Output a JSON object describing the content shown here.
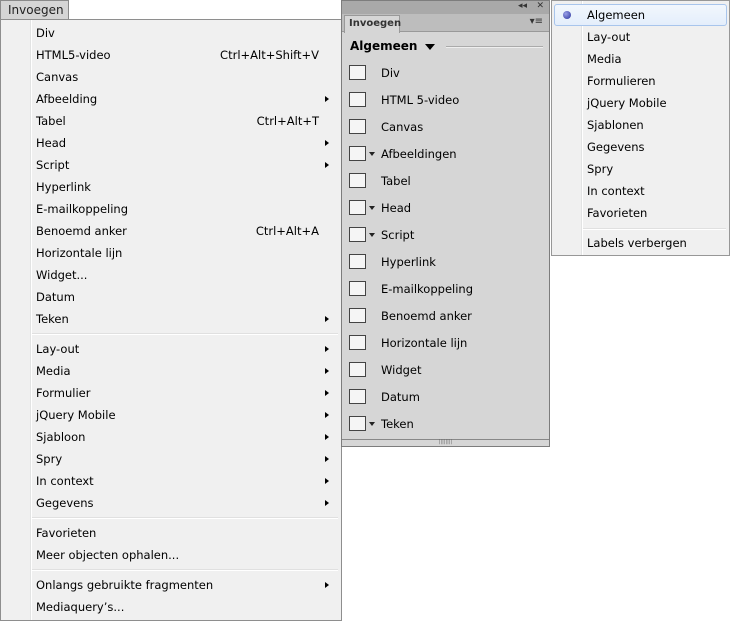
{
  "menubar": {
    "title": "Invoegen"
  },
  "menu": {
    "items": [
      {
        "label": "Div",
        "shortcut": "",
        "sub": false
      },
      {
        "label": "HTML5-video",
        "shortcut": "Ctrl+Alt+Shift+V",
        "sub": false
      },
      {
        "label": "Canvas",
        "shortcut": "",
        "sub": false
      },
      {
        "label": "Afbeelding",
        "shortcut": "",
        "sub": true
      },
      {
        "label": "Tabel",
        "shortcut": "Ctrl+Alt+T",
        "sub": false
      },
      {
        "label": "Head",
        "shortcut": "",
        "sub": true
      },
      {
        "label": "Script",
        "shortcut": "",
        "sub": true
      },
      {
        "label": "Hyperlink",
        "shortcut": "",
        "sub": false
      },
      {
        "label": "E-mailkoppeling",
        "shortcut": "",
        "sub": false
      },
      {
        "label": "Benoemd anker",
        "shortcut": "Ctrl+Alt+A",
        "sub": false
      },
      {
        "label": "Horizontale lijn",
        "shortcut": "",
        "sub": false
      },
      {
        "label": "Widget...",
        "shortcut": "",
        "sub": false
      },
      {
        "label": "Datum",
        "shortcut": "",
        "sub": false
      },
      {
        "label": "Teken",
        "shortcut": "",
        "sub": true
      },
      {
        "sep": true
      },
      {
        "label": "Lay-out",
        "shortcut": "",
        "sub": true
      },
      {
        "label": "Media",
        "shortcut": "",
        "sub": true
      },
      {
        "label": "Formulier",
        "shortcut": "",
        "sub": true
      },
      {
        "label": "jQuery Mobile",
        "shortcut": "",
        "sub": true
      },
      {
        "label": "Sjabloon",
        "shortcut": "",
        "sub": true
      },
      {
        "label": "Spry",
        "shortcut": "",
        "sub": true
      },
      {
        "label": "In context",
        "shortcut": "",
        "sub": true
      },
      {
        "label": "Gegevens",
        "shortcut": "",
        "sub": true
      },
      {
        "sep": true
      },
      {
        "label": "Favorieten",
        "shortcut": "",
        "sub": false
      },
      {
        "label": "Meer objecten ophalen...",
        "shortcut": "",
        "sub": false
      },
      {
        "sep": true
      },
      {
        "label": "Onlangs gebruikte fragmenten",
        "shortcut": "",
        "sub": true
      },
      {
        "label": "Mediaquery’s...",
        "shortcut": "",
        "sub": false
      }
    ]
  },
  "panel": {
    "tab": "Invoegen",
    "collapse": "◂◂",
    "close": "✕",
    "options": "▾≡",
    "category": "Algemeen",
    "items": [
      {
        "label": "Div",
        "icon": "div-icon",
        "dd": false
      },
      {
        "label": "HTML 5-video",
        "icon": "film-icon",
        "dd": false
      },
      {
        "label": "Canvas",
        "icon": "pencil-icon",
        "dd": false
      },
      {
        "label": "Afbeeldingen",
        "icon": "image-icon",
        "dd": true
      },
      {
        "label": "Tabel",
        "icon": "table-icon",
        "dd": false
      },
      {
        "label": "Head",
        "icon": "head-icon",
        "dd": true
      },
      {
        "label": "Script",
        "icon": "script-icon",
        "dd": true
      },
      {
        "label": "Hyperlink",
        "icon": "hyperlink-icon",
        "dd": false
      },
      {
        "label": "E-mailkoppeling",
        "icon": "email-icon",
        "dd": false
      },
      {
        "label": "Benoemd anker",
        "icon": "anchor-icon",
        "dd": false
      },
      {
        "label": "Horizontale lijn",
        "icon": "horizontal-rule-icon",
        "dd": false
      },
      {
        "label": "Widget",
        "icon": "gear-icon",
        "dd": false
      },
      {
        "label": "Datum",
        "icon": "calendar-icon",
        "dd": false
      },
      {
        "label": "Teken",
        "icon": "line-break-icon",
        "dd": true
      }
    ]
  },
  "popup": {
    "selected": "Algemeen",
    "items": [
      "Algemeen",
      "Lay-out",
      "Media",
      "Formulieren",
      "jQuery Mobile",
      "Sjablonen",
      "Gegevens",
      "Spry",
      "In context",
      "Favorieten"
    ],
    "extra": "Labels verbergen"
  }
}
